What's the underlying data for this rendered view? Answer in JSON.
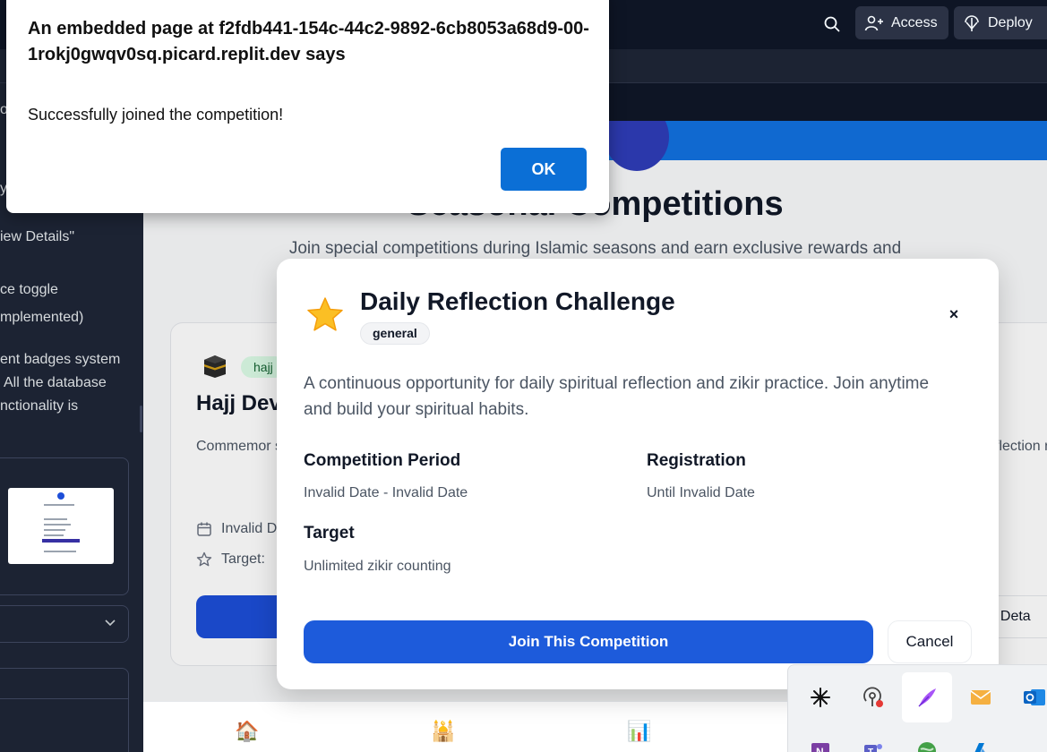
{
  "replit": {
    "access_label": "Access",
    "deploy_label": "Deploy",
    "icons": [
      "search-icon",
      "add-person-icon",
      "deploy-icon"
    ]
  },
  "agent_panel": {
    "lines": [
      "on",
      "y",
      "iew Details\"",
      "ce toggle",
      "mplemented)",
      "ent badges system",
      "All the database",
      "nctionality is"
    ]
  },
  "app": {
    "page_title": "Seasonal Competitions",
    "page_subtitle": "Join special competitions during Islamic seasons and earn exclusive rewards and",
    "left_card": {
      "badge": "hajj",
      "title": "Hajj Dev",
      "description": "Commemor sessions. P the Hajj exp",
      "date": "Invalid D",
      "target": "Target:",
      "icons": [
        "kaaba-icon",
        "calendar-icon",
        "star-outline-icon"
      ]
    },
    "right_card": {
      "description": "flection r spiritu",
      "view_details": "ew Deta"
    },
    "bottom_nav": {
      "icons": [
        "home-icon",
        "mosque-icon",
        "chart-icon"
      ],
      "emoji": [
        "🏠",
        "🕌",
        "📊"
      ]
    }
  },
  "modal": {
    "icon": "star-icon",
    "title": "Daily Reflection Challenge",
    "tag": "general",
    "close": "×",
    "description": "A continuous opportunity for daily spiritual reflection and zikir practice. Join anytime and build your spiritual habits.",
    "period_label": "Competition Period",
    "period_value": "Invalid Date - Invalid Date",
    "registration_label": "Registration",
    "registration_value": "Until Invalid Date",
    "target_label": "Target",
    "target_value": "Unlimited zikir counting",
    "join_label": "Join This Competition",
    "cancel_label": "Cancel"
  },
  "alert": {
    "title": "An embedded page at f2fdb441-154c-44c2-9892-6cb8053a68d9-00-1rokj0gwqv0sq.picard.replit.dev says",
    "message": "Successfully joined the competition!",
    "ok_label": "OK"
  },
  "tray": {
    "icons": [
      "claude-icon",
      "podcast-icon",
      "feather-icon",
      "mail-icon",
      "outlook-icon",
      "onenote-icon",
      "teams-icon",
      "globe-icon",
      "azure-icon"
    ]
  },
  "colors": {
    "primary": "#1d5bdb",
    "alert_ok": "#0b6fd6",
    "hero": "#1271e0",
    "badge_bg": "#dcfce7"
  }
}
